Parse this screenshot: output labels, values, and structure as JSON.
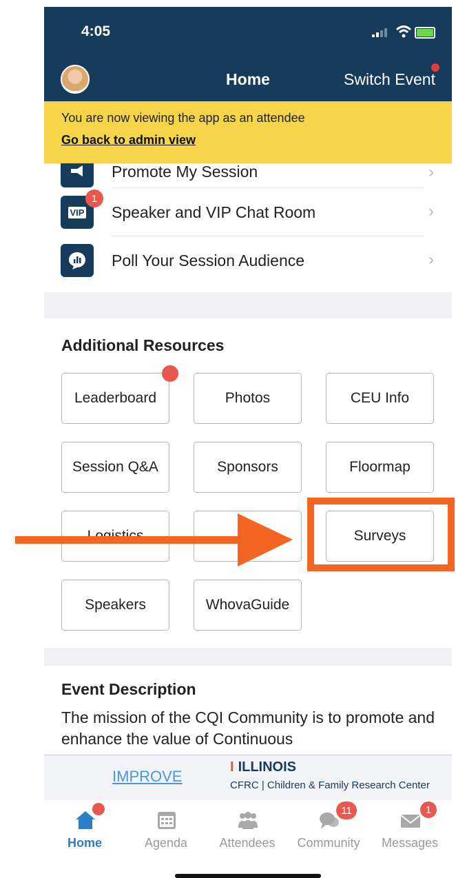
{
  "status_bar": {
    "time": "4:05"
  },
  "header": {
    "title": "Home",
    "switch_event": "Switch Event"
  },
  "banner": {
    "message": "You are now viewing the app as an attendee",
    "link": "Go back to admin view"
  },
  "quick_links": [
    {
      "label": "Promote My Session",
      "icon": "megaphone-icon"
    },
    {
      "label": "Speaker and VIP Chat Room",
      "icon": "vip-icon",
      "icon_text": "VIP",
      "badge": "1"
    },
    {
      "label": "Poll Your Session Audience",
      "icon": "poll-icon"
    }
  ],
  "additional_resources": {
    "title": "Additional Resources",
    "buttons": [
      "Leaderboard",
      "Photos",
      "CEU Info",
      "Session Q&A",
      "Sponsors",
      "Floormap",
      "Logistics",
      "",
      "Surveys",
      "Speakers",
      "WhovaGuide"
    ]
  },
  "event_description": {
    "title": "Event Description",
    "text": "The mission of the CQI Community is to promote and enhance the value of Continuous"
  },
  "ad": {
    "improve": "IMPROVE",
    "illinois": "ILLINOIS",
    "cfrc": "CFRC | Children & Family Research Center"
  },
  "tabbar": [
    {
      "label": "Home",
      "icon": "home-icon",
      "active": true
    },
    {
      "label": "Agenda",
      "icon": "calendar-icon"
    },
    {
      "label": "Attendees",
      "icon": "attendees-icon"
    },
    {
      "label": "Community",
      "icon": "community-icon",
      "badge": "11"
    },
    {
      "label": "Messages",
      "icon": "messages-icon",
      "badge": "1"
    }
  ],
  "colors": {
    "header": "#173b5a",
    "banner": "#f6d54a",
    "accent": "#2b7fc7",
    "badge": "#e9584f",
    "annotation": "#f26522"
  }
}
